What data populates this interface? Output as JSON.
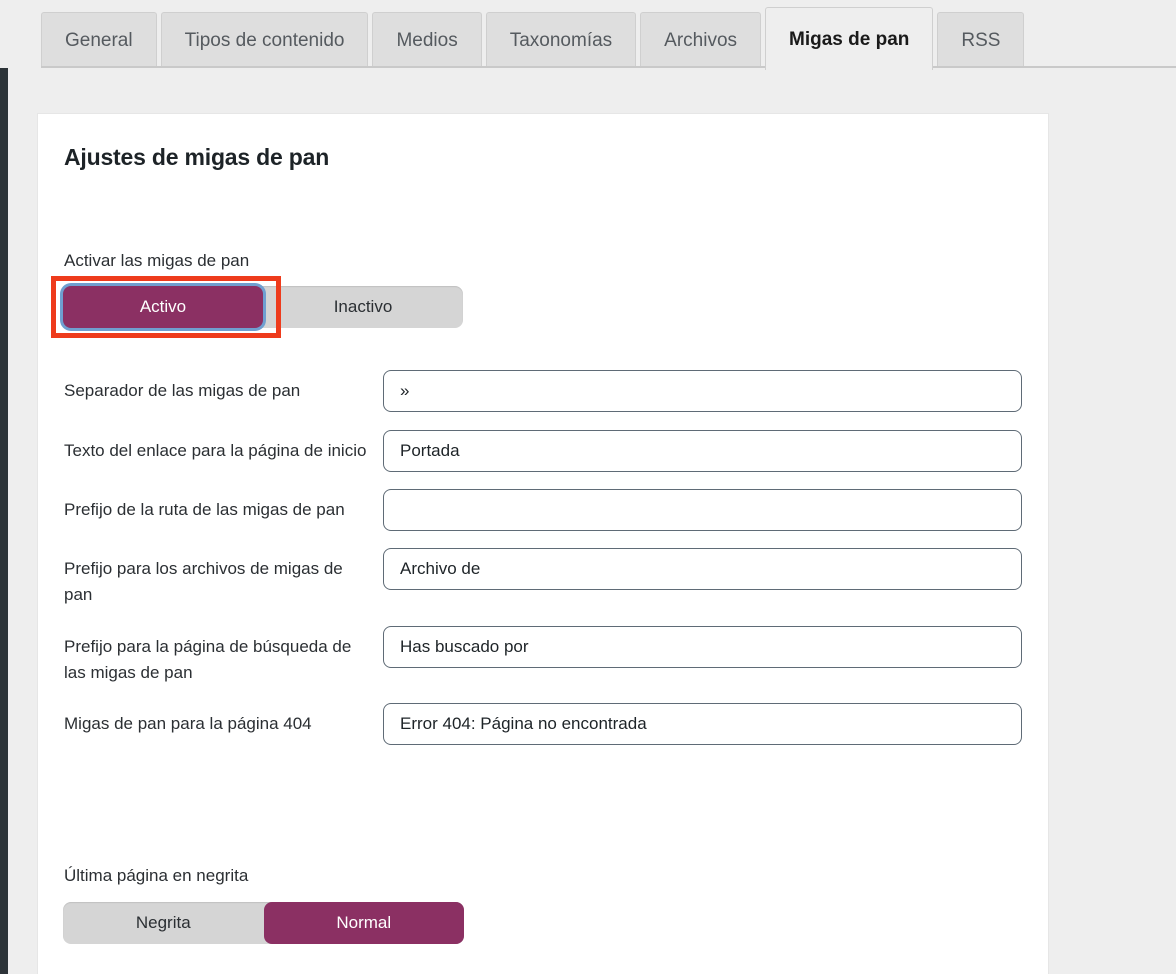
{
  "tabs": [
    {
      "label": "General",
      "active": false
    },
    {
      "label": "Tipos de contenido",
      "active": false
    },
    {
      "label": "Medios",
      "active": false
    },
    {
      "label": "Taxonomías",
      "active": false
    },
    {
      "label": "Archivos",
      "active": false
    },
    {
      "label": "Migas de pan",
      "active": true
    },
    {
      "label": "RSS",
      "active": false
    }
  ],
  "card": {
    "title": "Ajustes de migas de pan"
  },
  "enable_breadcrumbs": {
    "label": "Activar las migas de pan",
    "options": [
      {
        "label": "Activo",
        "selected": true,
        "focused": true
      },
      {
        "label": "Inactivo",
        "selected": false,
        "focused": false
      }
    ]
  },
  "fields": [
    {
      "label": "Separador de las migas de pan",
      "value": "»",
      "placeholder": ""
    },
    {
      "label": "Texto del enlace para la página de inicio",
      "value": "Portada",
      "placeholder": ""
    },
    {
      "label": "Prefijo de la ruta de las migas de pan",
      "value": "",
      "placeholder": ""
    },
    {
      "label": "Prefijo para los archivos de migas de pan",
      "value": "Archivo de",
      "placeholder": ""
    },
    {
      "label": "Prefijo para la página de búsqueda de las migas de pan",
      "value": "Has buscado por",
      "placeholder": ""
    },
    {
      "label": "Migas de pan para la página 404",
      "value": "Error 404: Página no encontrada",
      "placeholder": ""
    }
  ],
  "bold_last_page": {
    "label": "Última página en negrita",
    "options": [
      {
        "label": "Negrita",
        "selected": false,
        "focused": false
      },
      {
        "label": "Normal",
        "selected": true,
        "focused": false
      }
    ]
  },
  "colors": {
    "accent": "#8b3063",
    "focus_ring": "#6f9fd0",
    "annotation": "#ee3b1c",
    "page_bg": "#eeeeee",
    "card_bg": "#ffffff",
    "toggle_track": "#d5d5d5",
    "input_border": "#5f6b76",
    "text": "#2b2f33"
  }
}
